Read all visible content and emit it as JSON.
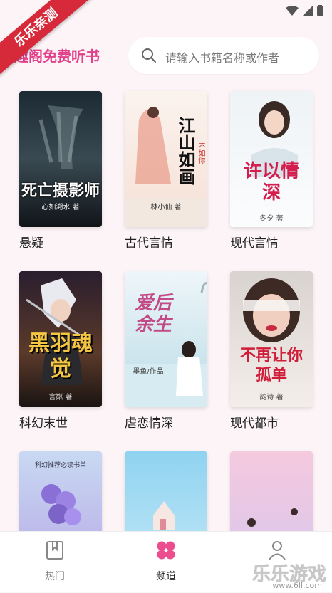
{
  "watermark_ribbon": "乐乐亲测",
  "header": {
    "title": "趣阁免费听书",
    "search_placeholder": "请输入书籍名称或作者"
  },
  "books": [
    {
      "label": "悬疑",
      "cover_title": "死亡摄影师",
      "author": "心如溯水 著"
    },
    {
      "label": "古代言情",
      "cover_title": "江山如画",
      "author": "林小仙 著",
      "badge": "不如你"
    },
    {
      "label": "现代言情",
      "cover_title": "许以情深",
      "author": "冬夕 著"
    },
    {
      "label": "科幻末世",
      "cover_title": "黑羽魂觉",
      "author": "言粼 著"
    },
    {
      "label": "虐恋情深",
      "cover_title": "爱后余生",
      "author": "墨鱼/作品"
    },
    {
      "label": "现代都市",
      "cover_title": "不再让你孤单",
      "author": "韵诗 著"
    },
    {
      "label": "",
      "cover_title": "",
      "author": "",
      "top_text": "科幻推荐必读书单"
    },
    {
      "label": "",
      "cover_title": "",
      "author": ""
    },
    {
      "label": "",
      "cover_title": "",
      "author": ""
    }
  ],
  "nav": [
    {
      "label": "热门",
      "icon": "bookmark-icon",
      "active": false
    },
    {
      "label": "频道",
      "icon": "clover-icon",
      "active": true
    },
    {
      "label": "",
      "icon": "profile-icon",
      "active": false
    }
  ],
  "watermark": {
    "text": "乐乐游戏",
    "sub": "www.6ll.com"
  },
  "colors": {
    "accent": "#e2408a",
    "ribbon": "#d62a3a",
    "background": "#fcf4f6"
  }
}
